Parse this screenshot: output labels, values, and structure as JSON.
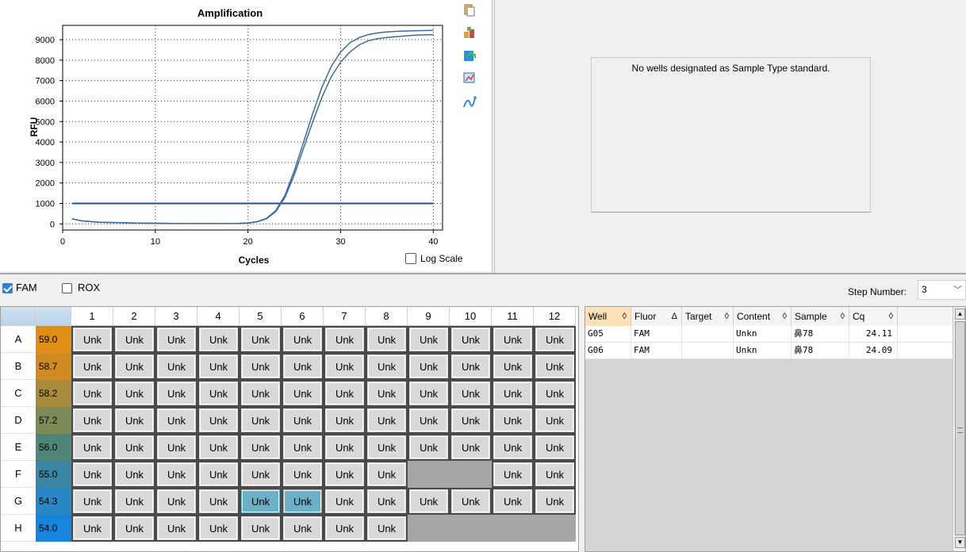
{
  "chart_data": {
    "type": "line",
    "title": "Amplification",
    "xlabel": "Cycles",
    "ylabel": "RFU",
    "xlim": [
      0,
      41
    ],
    "ylim": [
      -300,
      9700
    ],
    "xticks": [
      0,
      10,
      20,
      30,
      40
    ],
    "yticks": [
      0,
      1000,
      2000,
      3000,
      4000,
      5000,
      6000,
      7000,
      8000,
      9000
    ],
    "x_tick_labels": [
      "0",
      "10",
      "20",
      "30",
      "40"
    ],
    "y_tick_labels": [
      "0",
      "1000",
      "2000",
      "3000",
      "4000",
      "5000",
      "6000",
      "7000",
      "8000",
      "9000"
    ],
    "grid": "dotted",
    "series": [
      {
        "x": [
          1,
          2,
          3,
          4,
          5,
          6,
          8,
          10,
          12,
          14,
          16,
          18,
          19,
          20,
          21,
          22,
          23,
          24,
          25,
          26,
          27,
          28,
          29,
          30,
          31,
          32,
          33,
          34,
          35,
          36,
          38,
          40
        ],
        "values": [
          250,
          150,
          110,
          80,
          70,
          60,
          40,
          30,
          20,
          20,
          20,
          20,
          25,
          40,
          100,
          250,
          600,
          1300,
          2400,
          3700,
          5000,
          6200,
          7200,
          7900,
          8400,
          8750,
          8950,
          9050,
          9110,
          9150,
          9220,
          9250
        ]
      },
      {
        "x": [
          1,
          2,
          3,
          4,
          5,
          6,
          8,
          10,
          12,
          14,
          16,
          18,
          19,
          20,
          21,
          22,
          23,
          24,
          25,
          26,
          27,
          28,
          29,
          30,
          31,
          32,
          33,
          34,
          35,
          36,
          38,
          40
        ],
        "values": [
          250,
          150,
          110,
          80,
          70,
          60,
          40,
          30,
          20,
          20,
          20,
          20,
          25,
          40,
          110,
          270,
          650,
          1400,
          2600,
          4000,
          5400,
          6700,
          7700,
          8400,
          8850,
          9100,
          9250,
          9330,
          9380,
          9410,
          9440,
          9460
        ]
      }
    ],
    "threshold": 1000,
    "colors": {
      "curves": "#3d6a9a",
      "threshold": "#1f4e8c"
    }
  },
  "log_scale_label": "Log Scale",
  "std_message": "No wells designated as Sample Type standard.",
  "channels": [
    {
      "label": "FAM",
      "checked": true
    },
    {
      "label": "ROX",
      "checked": false
    }
  ],
  "step": {
    "label": "Step Number:",
    "value": "3"
  },
  "plate": {
    "columns": [
      "1",
      "2",
      "3",
      "4",
      "5",
      "6",
      "7",
      "8",
      "9",
      "10",
      "11",
      "12"
    ],
    "rows": [
      {
        "label": "A",
        "temp": "59.0",
        "color": "#e08f16",
        "wells": [
          "Unk",
          "Unk",
          "Unk",
          "Unk",
          "Unk",
          "Unk",
          "Unk",
          "Unk",
          "Unk",
          "Unk",
          "Unk",
          "Unk"
        ]
      },
      {
        "label": "B",
        "temp": "58.7",
        "color": "#d08b22",
        "wells": [
          "Unk",
          "Unk",
          "Unk",
          "Unk",
          "Unk",
          "Unk",
          "Unk",
          "Unk",
          "Unk",
          "Unk",
          "Unk",
          "Unk"
        ]
      },
      {
        "label": "C",
        "temp": "58.2",
        "color": "#a88a3c",
        "wells": [
          "Unk",
          "Unk",
          "Unk",
          "Unk",
          "Unk",
          "Unk",
          "Unk",
          "Unk",
          "Unk",
          "Unk",
          "Unk",
          "Unk"
        ]
      },
      {
        "label": "D",
        "temp": "57.2",
        "color": "#7c8a58",
        "wells": [
          "Unk",
          "Unk",
          "Unk",
          "Unk",
          "Unk",
          "Unk",
          "Unk",
          "Unk",
          "Unk",
          "Unk",
          "Unk",
          "Unk"
        ]
      },
      {
        "label": "E",
        "temp": "56.0",
        "color": "#4f8678",
        "wells": [
          "Unk",
          "Unk",
          "Unk",
          "Unk",
          "Unk",
          "Unk",
          "Unk",
          "Unk",
          "Unk",
          "Unk",
          "Unk",
          "Unk"
        ]
      },
      {
        "label": "F",
        "temp": "55.0",
        "color": "#3a86a4",
        "wells": [
          "Unk",
          "Unk",
          "Unk",
          "Unk",
          "Unk",
          "Unk",
          "Unk",
          "Unk",
          "",
          "",
          "Unk",
          "Unk"
        ]
      },
      {
        "label": "G",
        "temp": "54.3",
        "color": "#2887c4",
        "wells": [
          "Unk",
          "Unk",
          "Unk",
          "Unk",
          "Unk",
          "Unk",
          "Unk",
          "Unk",
          "Unk",
          "Unk",
          "Unk",
          "Unk"
        ],
        "selected": [
          4,
          5
        ]
      },
      {
        "label": "H",
        "temp": "54.0",
        "color": "#1784dd",
        "wells": [
          "Unk",
          "Unk",
          "Unk",
          "Unk",
          "Unk",
          "Unk",
          "Unk",
          "Unk",
          "",
          "",
          "",
          ""
        ]
      }
    ]
  },
  "results": {
    "headers": [
      {
        "label": "Well",
        "sort": "◊"
      },
      {
        "label": "Fluor",
        "sort": "Δ"
      },
      {
        "label": "Target",
        "sort": "◊"
      },
      {
        "label": "Content",
        "sort": "◊"
      },
      {
        "label": "Sample",
        "sort": "◊"
      },
      {
        "label": "Cq",
        "sort": "◊"
      }
    ],
    "rows": [
      {
        "well": "G05",
        "fluor": "FAM",
        "target": "",
        "content": "Unkn",
        "sample": "鼻78",
        "cq": "24.11"
      },
      {
        "well": "G06",
        "fluor": "FAM",
        "target": "",
        "content": "Unkn",
        "sample": "鼻78",
        "cq": "24.09"
      }
    ]
  },
  "toolbar_icons": [
    "copy-icon",
    "export-icon",
    "export-graph-icon",
    "chart-options-icon",
    "curve-icon"
  ]
}
